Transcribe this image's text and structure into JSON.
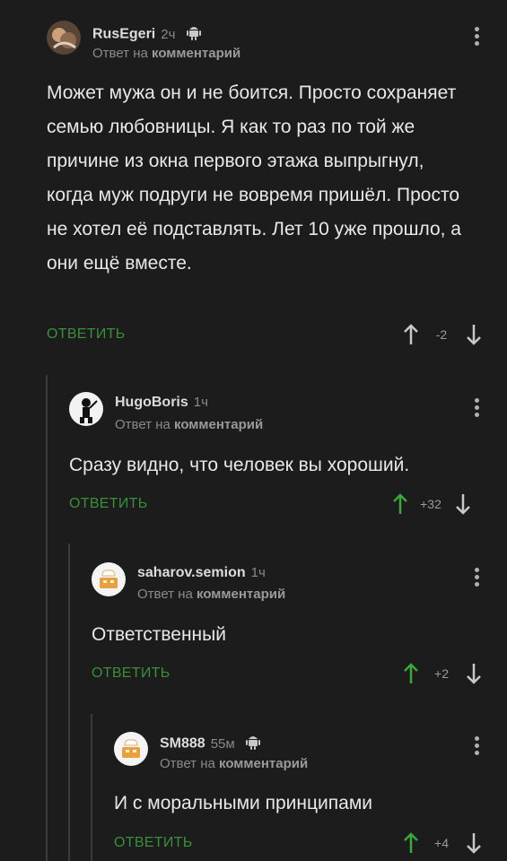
{
  "comments": [
    {
      "username": "RusEgeri",
      "time": "2ч",
      "reply_prefix": "Ответ на",
      "reply_target": "комментарий",
      "text": "Может мужа он и не боится. Просто сохраняет семью любовницы. Я как то раз по той же причине из окна первого этажа выпрыгнул, когда муж подруги не вовремя пришёл. Просто не хотел её подставлять. Лет 10 уже прошло, а они ещё вместе.",
      "reply_label": "ОТВЕТИТЬ",
      "rating": "-2",
      "android_icon": "android-icon"
    },
    {
      "username": "HugoBoris",
      "time": "1ч",
      "reply_prefix": "Ответ на",
      "reply_target": "комментарий",
      "text": "Сразу видно, что человек вы хороший.",
      "reply_label": "ОТВЕТИТЬ",
      "rating": "+32"
    },
    {
      "username": "saharov.semion",
      "time": "1ч",
      "reply_prefix": "Ответ на",
      "reply_target": "комментарий",
      "text": "Ответственный",
      "reply_label": "ОТВЕТИТЬ",
      "rating": "+2"
    },
    {
      "username": "SM888",
      "time": "55м",
      "reply_prefix": "Ответ на",
      "reply_target": "комментарий",
      "text": "И с моральными принципами",
      "reply_label": "ОТВЕТИТЬ",
      "rating": "+4",
      "android_icon": "android-icon"
    }
  ],
  "colors": {
    "background": "#1c1c1c",
    "reply_green": "#3a8f3a",
    "upvote_active": "#3aa83a",
    "muted": "#8a8a8a"
  }
}
